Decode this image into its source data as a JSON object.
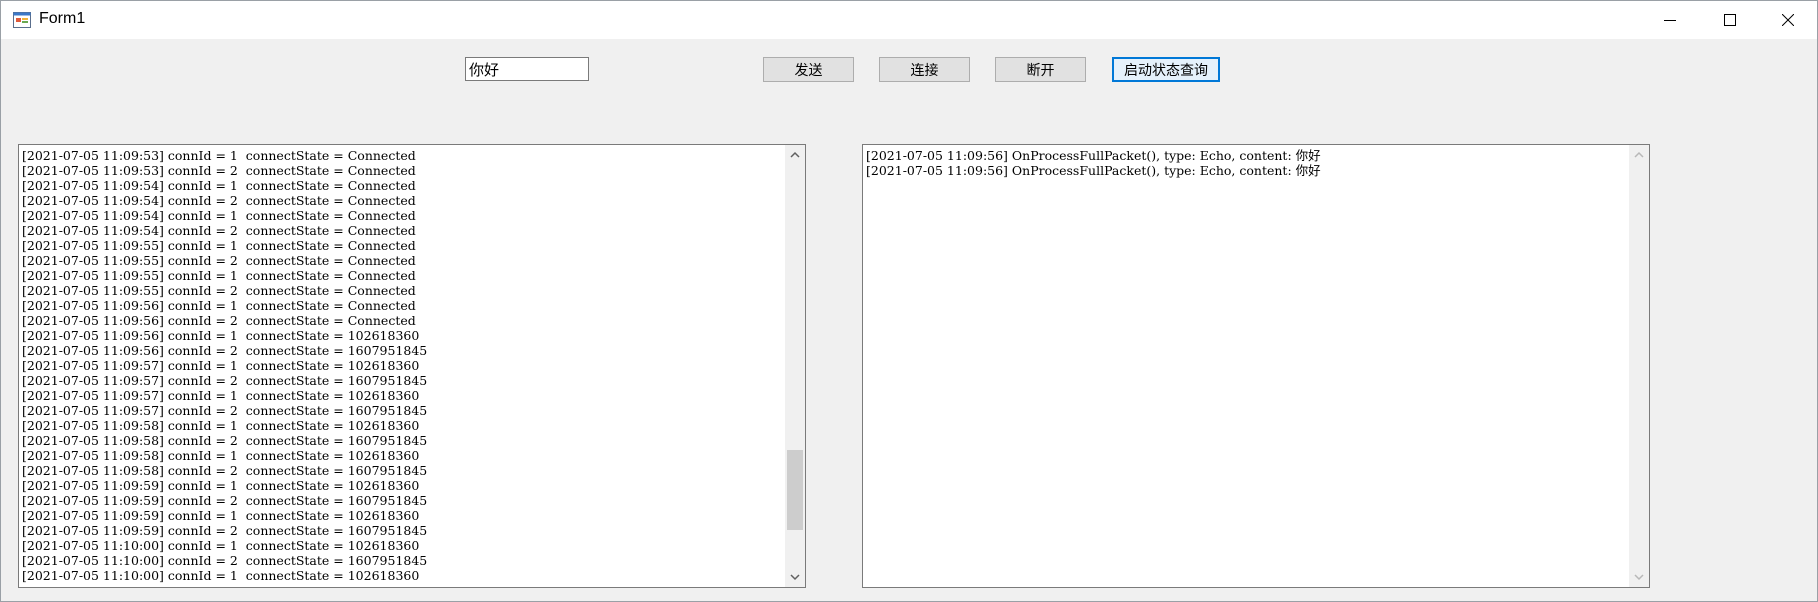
{
  "window": {
    "title": "Form1"
  },
  "toolbar": {
    "message_value": "你好",
    "send_label": "发送",
    "connect_label": "连接",
    "disconnect_label": "断开",
    "status_query_label": "启动状态查询"
  },
  "left_log": {
    "lines": [
      "[2021-07-05 11:09:53] connId = 1  connectState = Connected",
      "[2021-07-05 11:09:53] connId = 2  connectState = Connected",
      "[2021-07-05 11:09:54] connId = 1  connectState = Connected",
      "[2021-07-05 11:09:54] connId = 2  connectState = Connected",
      "[2021-07-05 11:09:54] connId = 1  connectState = Connected",
      "[2021-07-05 11:09:54] connId = 2  connectState = Connected",
      "[2021-07-05 11:09:55] connId = 1  connectState = Connected",
      "[2021-07-05 11:09:55] connId = 2  connectState = Connected",
      "[2021-07-05 11:09:55] connId = 1  connectState = Connected",
      "[2021-07-05 11:09:55] connId = 2  connectState = Connected",
      "[2021-07-05 11:09:56] connId = 1  connectState = Connected",
      "[2021-07-05 11:09:56] connId = 2  connectState = Connected",
      "[2021-07-05 11:09:56] connId = 1  connectState = 102618360",
      "[2021-07-05 11:09:56] connId = 2  connectState = 1607951845",
      "[2021-07-05 11:09:57] connId = 1  connectState = 102618360",
      "[2021-07-05 11:09:57] connId = 2  connectState = 1607951845",
      "[2021-07-05 11:09:57] connId = 1  connectState = 102618360",
      "[2021-07-05 11:09:57] connId = 2  connectState = 1607951845",
      "[2021-07-05 11:09:58] connId = 1  connectState = 102618360",
      "[2021-07-05 11:09:58] connId = 2  connectState = 1607951845",
      "[2021-07-05 11:09:58] connId = 1  connectState = 102618360",
      "[2021-07-05 11:09:58] connId = 2  connectState = 1607951845",
      "[2021-07-05 11:09:59] connId = 1  connectState = 102618360",
      "[2021-07-05 11:09:59] connId = 2  connectState = 1607951845",
      "[2021-07-05 11:09:59] connId = 1  connectState = 102618360",
      "[2021-07-05 11:09:59] connId = 2  connectState = 1607951845",
      "[2021-07-05 11:10:00] connId = 1  connectState = 102618360",
      "[2021-07-05 11:10:00] connId = 2  connectState = 1607951845",
      "[2021-07-05 11:10:00] connId = 1  connectState = 102618360"
    ]
  },
  "right_log": {
    "lines": [
      "[2021-07-05 11:09:56] OnProcessFullPacket(), type: Echo, content: 你好",
      "[2021-07-05 11:09:56] OnProcessFullPacket(), type: Echo, content: 你好"
    ]
  },
  "icons": {
    "app": "form-app-icon",
    "minimize": "minimize-icon",
    "maximize": "maximize-icon",
    "close": "close-icon",
    "scroll_up": "chevron-up-icon",
    "scroll_down": "chevron-down-icon"
  },
  "colors": {
    "background": "#f0f0f0",
    "focus_border": "#0078d7",
    "button_face": "#e1e1e1"
  }
}
